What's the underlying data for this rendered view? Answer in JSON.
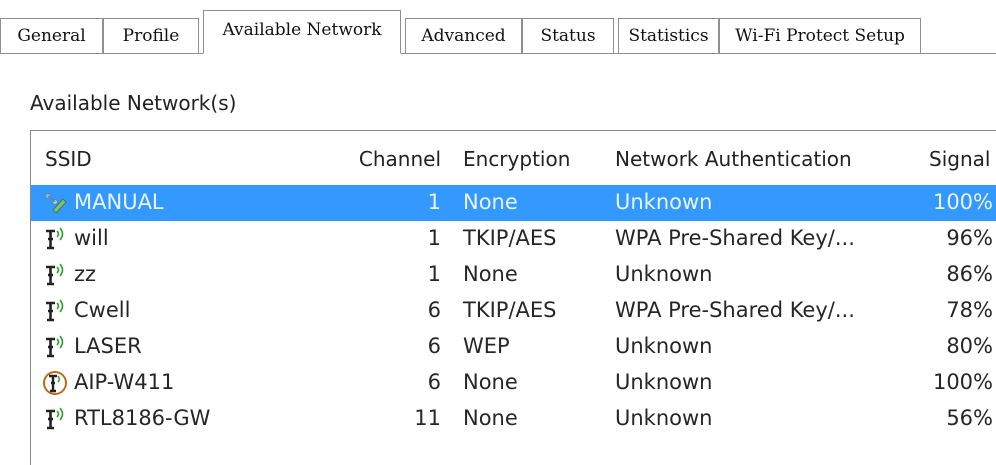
{
  "tabs": [
    {
      "label": "General"
    },
    {
      "label": "Profile"
    },
    {
      "label": "Available Network"
    },
    {
      "label": "Advanced"
    },
    {
      "label": "Status"
    },
    {
      "label": "Statistics"
    },
    {
      "label": "Wi-Fi Protect Setup"
    }
  ],
  "group_label": "Available Network(s)",
  "columns": {
    "ssid": "SSID",
    "channel": "Channel",
    "encryption": "Encryption",
    "auth": "Network Authentication",
    "signal": "Signal"
  },
  "networks": [
    {
      "icon": "manual-network-icon",
      "ssid": "MANUAL",
      "channel": "1",
      "encryption": "None",
      "auth": "Unknown",
      "signal": "100%"
    },
    {
      "icon": "ap-signal-icon",
      "ssid": "will",
      "channel": "1",
      "encryption": "TKIP/AES",
      "auth": "WPA Pre-Shared Key/...",
      "signal": "96%"
    },
    {
      "icon": "ap-signal-icon",
      "ssid": "zz",
      "channel": "1",
      "encryption": "None",
      "auth": "Unknown",
      "signal": "86%"
    },
    {
      "icon": "ap-signal-icon",
      "ssid": "Cwell",
      "channel": "6",
      "encryption": "TKIP/AES",
      "auth": "WPA Pre-Shared Key/...",
      "signal": "78%"
    },
    {
      "icon": "ap-signal-icon",
      "ssid": "LASER",
      "channel": "6",
      "encryption": "WEP",
      "auth": "Unknown",
      "signal": "80%"
    },
    {
      "icon": "ap-connected-icon",
      "ssid": "AIP-W411",
      "channel": "6",
      "encryption": "None",
      "auth": "Unknown",
      "signal": "100%"
    },
    {
      "icon": "ap-signal-icon",
      "ssid": "RTL8186-GW",
      "channel": "11",
      "encryption": "None",
      "auth": "Unknown",
      "signal": "56%"
    }
  ],
  "selected_row": 0,
  "colors": {
    "selection": "#3399ff",
    "signal_waves": "#2e9e2e",
    "connected_ring": "#c06a1a"
  }
}
